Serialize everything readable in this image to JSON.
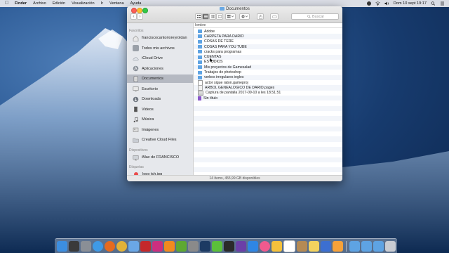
{
  "menubar": {
    "app": "Finder",
    "items": [
      "Archivo",
      "Edición",
      "Visualización",
      "Ir",
      "Ventana",
      "Ayuda"
    ],
    "clock": "Dom 10 sept  19:17"
  },
  "window": {
    "title": "Documentos",
    "search_placeholder": "Buscar",
    "column_header": "lombre",
    "status": "14 ítems, 455,99 GB disponibles"
  },
  "sidebar": {
    "favorites_heading": "Favoritos",
    "favorites": [
      {
        "label": "franciscocantorioreyroldan",
        "icon": "home-icon"
      },
      {
        "label": "Todos mis archivos",
        "icon": "all-files-icon"
      },
      {
        "label": "iCloud Drive",
        "icon": "cloud-icon"
      },
      {
        "label": "Aplicaciones",
        "icon": "applications-icon"
      },
      {
        "label": "Documentos",
        "icon": "documents-icon",
        "selected": true
      },
      {
        "label": "Escritorio",
        "icon": "desktop-icon"
      },
      {
        "label": "Downloads",
        "icon": "downloads-icon"
      },
      {
        "label": "Videos",
        "icon": "movies-icon"
      },
      {
        "label": "Música",
        "icon": "music-icon"
      },
      {
        "label": "Imágenes",
        "icon": "pictures-icon"
      },
      {
        "label": "Creative Cloud Files",
        "icon": "folder-icon"
      }
    ],
    "devices_heading": "Dispositivos",
    "devices": [
      {
        "label": "iMac de FRANCISCO",
        "icon": "imac-icon"
      }
    ],
    "tags_heading": "Etiquetas",
    "tags": [
      {
        "label": "logo tch.jpg",
        "color": "#ea4b4b"
      }
    ]
  },
  "files": [
    {
      "name": "Adobe",
      "kind": "folder"
    },
    {
      "name": "CARPETA PARA DARIO",
      "kind": "folder"
    },
    {
      "name": "COSAS DE TERE",
      "kind": "folder"
    },
    {
      "name": "COSAS PARA YOU TUBE",
      "kind": "folder"
    },
    {
      "name": "cracks para programas",
      "kind": "folder"
    },
    {
      "name": "CUENTAS",
      "kind": "folder"
    },
    {
      "name": "ESTUDIOS",
      "kind": "folder"
    },
    {
      "name": "Mis proyectos de Gamesalad",
      "kind": "folder"
    },
    {
      "name": "Trabajos de photoshop",
      "kind": "folder"
    },
    {
      "name": "verbos irregulares ingles",
      "kind": "folder"
    },
    {
      "name": "actor sigue raton.gameproj",
      "kind": "doc"
    },
    {
      "name": "ARBOL GENEALOGICO DE DARIO.pages",
      "kind": "pages"
    },
    {
      "name": "Captura de pantalla 2017-09-10 a les 18.51.51",
      "kind": "img"
    },
    {
      "name": "Sin título",
      "kind": "purple"
    }
  ],
  "dock": {
    "apps": [
      {
        "name": "finder-icon",
        "color": "#3c8ee0"
      },
      {
        "name": "dashboard-icon",
        "color": "#3a3a3a"
      },
      {
        "name": "system-preferences-icon",
        "color": "#8a8f96"
      },
      {
        "name": "safari-icon",
        "color": "#3f9ae6"
      },
      {
        "name": "firefox-icon",
        "color": "#e66a1f"
      },
      {
        "name": "chrome-icon",
        "color": "#e2b238"
      },
      {
        "name": "mail-icon",
        "color": "#6aa7e6"
      },
      {
        "name": "flash-icon",
        "color": "#c4282b"
      },
      {
        "name": "photo-app-icon",
        "color": "#cc2f7f"
      },
      {
        "name": "vlc-icon",
        "color": "#f18a1f"
      },
      {
        "name": "gamesalad-icon",
        "color": "#5ea832"
      },
      {
        "name": "launchpad-icon",
        "color": "#8a8a8a"
      },
      {
        "name": "photoshop-icon",
        "color": "#1c3a63"
      },
      {
        "name": "camtasia-icon",
        "color": "#5bbf3a"
      },
      {
        "name": "quicktime-icon",
        "color": "#2a2a2a"
      },
      {
        "name": "imovie-icon",
        "color": "#6b3fa7"
      },
      {
        "name": "app-store-icon",
        "color": "#2f86e4"
      },
      {
        "name": "itunes-icon",
        "color": "#f05a8e"
      },
      {
        "name": "photos-icon",
        "color": "#f4c13c"
      },
      {
        "name": "calendar-icon",
        "color": "#ffffff"
      },
      {
        "name": "contacts-icon",
        "color": "#b48a54"
      },
      {
        "name": "notes-icon",
        "color": "#f4d35e"
      },
      {
        "name": "keynote-icon",
        "color": "#3c6fd1"
      },
      {
        "name": "pages-icon",
        "color": "#f6a23a"
      },
      {
        "name": "folder-dock-icon",
        "color": "#5ea3e3"
      },
      {
        "name": "downloads-stack-icon",
        "color": "#5ea3e3"
      },
      {
        "name": "documents-stack-icon",
        "color": "#5ea3e3"
      },
      {
        "name": "trash-icon",
        "color": "#c9ccd2"
      }
    ]
  }
}
